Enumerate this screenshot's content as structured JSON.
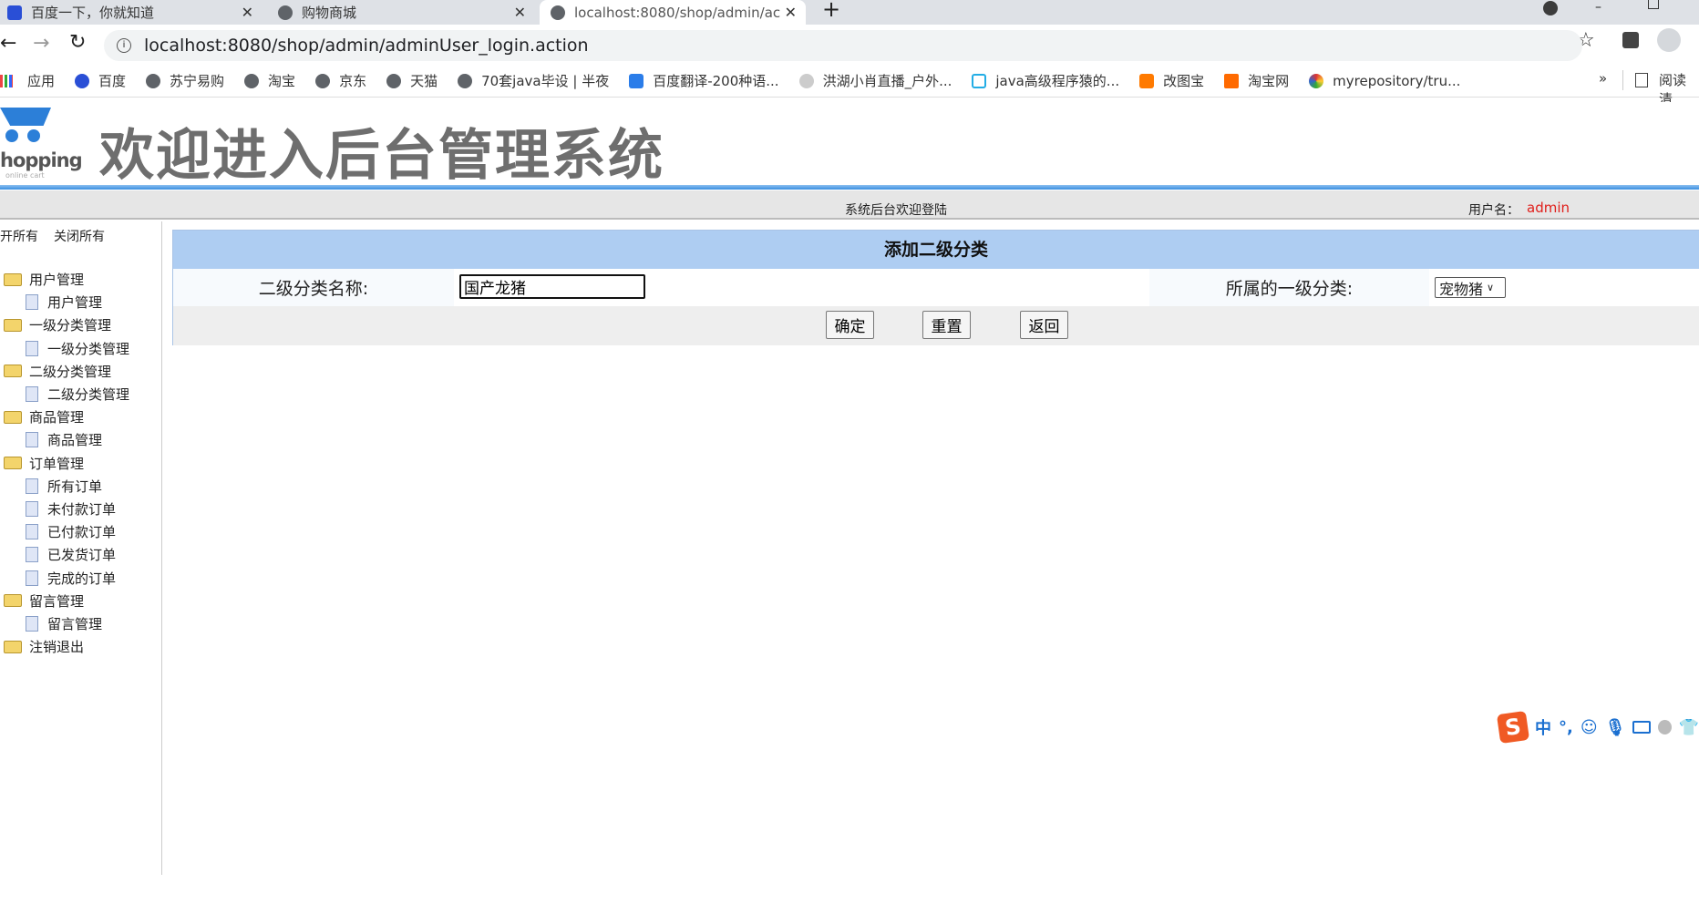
{
  "browser": {
    "tabs": [
      {
        "title": "百度一下，你就知道",
        "active": false
      },
      {
        "title": "购物商城",
        "active": false
      },
      {
        "title": "localhost:8080/shop/admin/ac",
        "active": true
      }
    ],
    "url": "localhost:8080/shop/admin/adminUser_login.action",
    "bookmarks": [
      "应用",
      "百度",
      "苏宁易购",
      "淘宝",
      "京东",
      "天猫",
      "70套java毕设 | 半夜",
      "百度翻译-200种语...",
      "洪湖小肖直播_户外...",
      "java高级程序猿的...",
      "改图宝",
      "淘宝网",
      "myrepository/tru..."
    ],
    "more": "»",
    "reading_list": "阅读清"
  },
  "header": {
    "title": "欢迎进入后台管理系统",
    "logo_text": "hopping",
    "logo_sub": "online cart"
  },
  "topbar": {
    "welcome": "系统后台欢迎登陆",
    "user_label": "用户名：",
    "user_name": "admin",
    "user_color": "#e0201c"
  },
  "sidebar": {
    "expand_all": "开所有",
    "collapse_all": "关闭所有",
    "groups": [
      {
        "label": "用户管理",
        "items": [
          "用户管理"
        ]
      },
      {
        "label": "一级分类管理",
        "items": [
          "一级分类管理"
        ]
      },
      {
        "label": "二级分类管理",
        "items": [
          "二级分类管理"
        ]
      },
      {
        "label": "商品管理",
        "items": [
          "商品管理"
        ]
      },
      {
        "label": "订单管理",
        "items": [
          "所有订单",
          "未付款订单",
          "已付款订单",
          "已发货订单",
          "完成的订单"
        ]
      },
      {
        "label": "留言管理",
        "items": [
          "留言管理"
        ]
      },
      {
        "label": "注销退出",
        "items": []
      }
    ]
  },
  "form": {
    "title": "添加二级分类",
    "name_label": "二级分类名称:",
    "name_value": "国产龙猪",
    "parent_label": "所属的一级分类:",
    "parent_selected": "宠物猪",
    "confirm": "确定",
    "reset": "重置",
    "back": "返回"
  },
  "ime": {
    "mode": "中",
    "punct": "°,"
  }
}
